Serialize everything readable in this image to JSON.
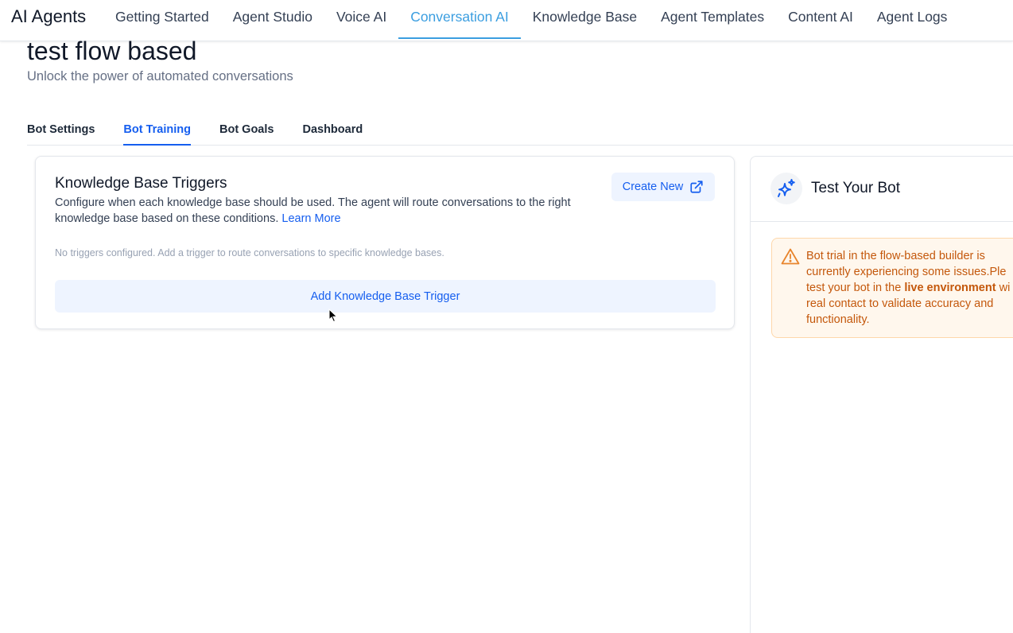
{
  "nav": {
    "brand": "AI Agents",
    "items": [
      {
        "label": "Getting Started"
      },
      {
        "label": "Agent Studio"
      },
      {
        "label": "Voice AI"
      },
      {
        "label": "Conversation AI"
      },
      {
        "label": "Knowledge Base"
      },
      {
        "label": "Agent Templates"
      },
      {
        "label": "Content AI"
      },
      {
        "label": "Agent Logs"
      }
    ],
    "active": "Conversation AI"
  },
  "page": {
    "title": "test flow based",
    "subtitle": "Unlock the power of automated conversations"
  },
  "tabs": [
    {
      "label": "Bot Settings"
    },
    {
      "label": "Bot Training"
    },
    {
      "label": "Bot Goals"
    },
    {
      "label": "Dashboard"
    }
  ],
  "active_tab": "Bot Training",
  "kb_triggers": {
    "title": "Knowledge Base Triggers",
    "description": "Configure when each knowledge base should be used. The agent will route conversations to the right knowledge base based on these conditions.",
    "learn_more": "Learn More",
    "create_new": "Create New",
    "empty_message": "No triggers configured. Add a trigger to route conversations to specific knowledge bases.",
    "add_button": "Add Knowledge Base Trigger"
  },
  "test_panel": {
    "title": "Test Your Bot",
    "warning": {
      "line1": "Bot trial in the flow-based builder is",
      "line2": "currently experiencing some issues.Ple",
      "line3_pre": "test your bot in the ",
      "line3_bold": "live environment",
      "line3_post": " wi",
      "line4": "real contact to validate accuracy and",
      "line5": "functionality."
    }
  },
  "colors": {
    "accent_nav": "#3b9ee0",
    "primary": "#155eef",
    "warning_text": "#c4580c",
    "warning_bg": "#fff7ed"
  }
}
